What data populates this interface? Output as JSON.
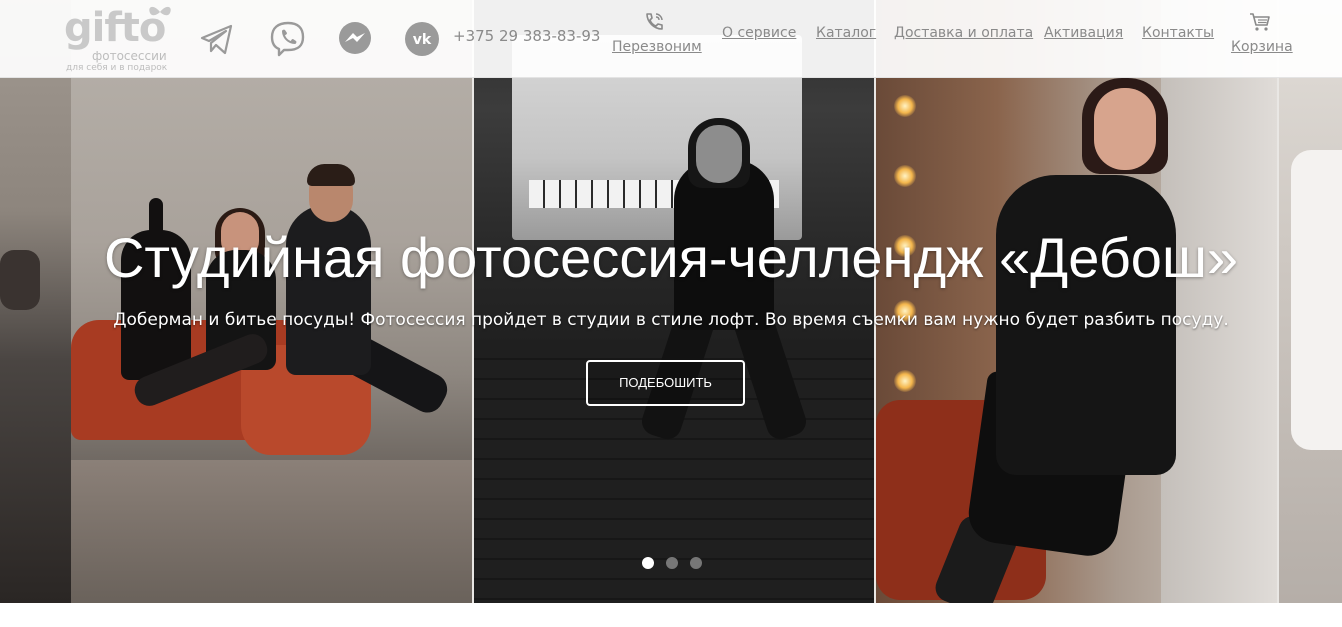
{
  "header": {
    "logo": {
      "word": "gifto",
      "subtitle": "фотосессии",
      "tagline": "для себя и в подарок"
    },
    "socials": [
      {
        "name": "Telegram",
        "icon": "telegram-icon"
      },
      {
        "name": "Viber",
        "icon": "viber-icon"
      },
      {
        "name": "Messenger",
        "icon": "messenger-icon"
      },
      {
        "name": "VK",
        "icon": "vk-icon"
      }
    ],
    "phone": "+375 29 383-83-93",
    "callback": {
      "label": "Перезвоним",
      "icon": "phone-ring-icon"
    },
    "nav": [
      {
        "label": "О сервисе"
      },
      {
        "label": "Каталог"
      },
      {
        "label": "Доставка и оплата"
      },
      {
        "label": "Активация"
      },
      {
        "label": "Контакты"
      }
    ],
    "cart": {
      "label": "Корзина",
      "icon": "cart-icon"
    }
  },
  "slider": {
    "title": "Студийная фотосессия-челлендж «Дебош»",
    "subtitle": "Доберман и битье посуды! Фотосессия пройдет в студии в стиле лофт. Во время съемки вам нужно будет разбить посуду.",
    "cta_label": "ПОДЕБОШИТЬ",
    "slides_count": 3,
    "active_slide": 1
  },
  "colors": {
    "header_bg": "#ffffff",
    "nav_text": "#8a8a8a",
    "logo_gray": "#c9c9c9",
    "hero_text": "#ffffff"
  }
}
